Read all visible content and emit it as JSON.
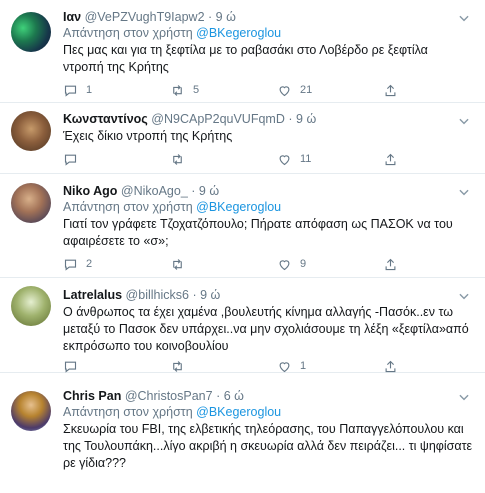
{
  "labels": {
    "replying_prefix": "Απάντηση στον χρήστη",
    "time_sep": "·"
  },
  "tweets": [
    {
      "name": "Ιαν",
      "handle": "@VePZVughT9Iapw2",
      "time": "9 ώ",
      "reply_to": "@BKegeroglou",
      "text": "Πες μας και για τη ξεφτίλα με το ραβασάκι στο Λοβέρδο ρε ξεφτίλα\nντροπή της Κρήτης",
      "replies": "1",
      "retweets": "5",
      "likes": "21"
    },
    {
      "name": "Κωνσταντίνος",
      "handle": "@N9CApP2quVUFqmD",
      "time": "9 ώ",
      "reply_to": "",
      "text": "Έχεις δίκιο ντροπή της Κρήτης",
      "replies": "",
      "retweets": "",
      "likes": "11"
    },
    {
      "name": "Niko Ago",
      "handle": "@NikoAgo_",
      "time": "9 ώ",
      "reply_to": "@BKegeroglou",
      "text": "Γιατί τον γράφετε Τζοχατζόπουλο; Πήρατε απόφαση ως ΠΑΣΟΚ να του\nαφαιρέσετε το «σ»;",
      "replies": "2",
      "retweets": "",
      "likes": "9"
    },
    {
      "name": "Latrelalus",
      "handle": "@billhicks6",
      "time": "9 ώ",
      "reply_to": "",
      "text": "Ο άνθρωπος τα έχει χαμένα ,βουλευτής κίνημα αλλαγής -Πασόκ..εν τω\nμεταξύ το Πασοκ δεν υπάρχει..να μην σχολιάσουμε τη λέξη «ξεφτίλα»από\nεκπρόσωπο του κοινοβουλίου",
      "replies": "",
      "retweets": "",
      "likes": "1"
    },
    {
      "name": "Chris Pan",
      "handle": "@ChristosPan7",
      "time": "6 ώ",
      "reply_to": "@BKegeroglou",
      "text": "Σκευωρία του FBI, της ελβετικής τηλεόρασης, του Παπαγγελόπουλου και\nτης Τουλουπάκη...λίγο ακριβή η σκευωρία αλλά δεν πειράζει... τι ψηφίσατε\nρε γίδια???",
      "replies": "",
      "retweets": "",
      "likes": ""
    }
  ]
}
